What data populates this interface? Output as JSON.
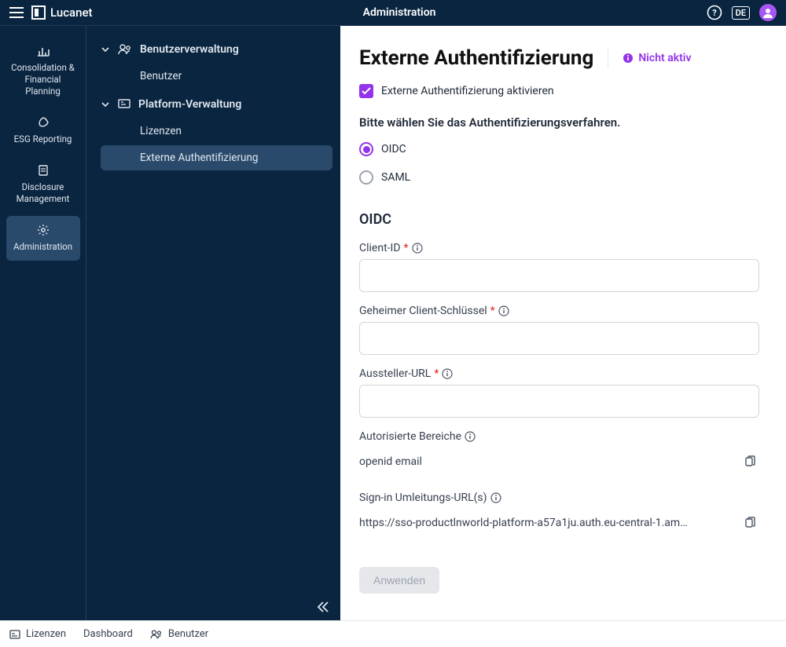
{
  "topbar": {
    "brand": "Lucanet",
    "title": "Administration",
    "lang": "DE"
  },
  "rail": {
    "items": [
      {
        "label": "Consolidation & Financial Planning",
        "icon": "chart"
      },
      {
        "label": "ESG Reporting",
        "icon": "leaf"
      },
      {
        "label": "Disclosure Management",
        "icon": "doc"
      },
      {
        "label": "Administration",
        "icon": "gear",
        "active": true
      }
    ]
  },
  "secondary": {
    "groups": [
      {
        "label": "Benutzerverwaltung",
        "icon": "users",
        "children": [
          {
            "label": "Benutzer"
          }
        ]
      },
      {
        "label": "Platform-Verwaltung",
        "icon": "platform",
        "children": [
          {
            "label": "Lizenzen"
          },
          {
            "label": "Externe Authentifizierung",
            "active": true
          }
        ]
      }
    ]
  },
  "content": {
    "heading": "Externe Authentifizierung",
    "status": "Nicht aktiv",
    "enable_label": "Externe Authentifizierung aktivieren",
    "enable_checked": true,
    "prompt": "Bitte wählen Sie das Authentifizierungsverfahren.",
    "radios": {
      "oidc": "OIDC",
      "saml": "SAML",
      "selected": "oidc"
    },
    "section_heading": "OIDC",
    "fields": {
      "client_id": {
        "label": "Client-ID",
        "required": true,
        "value": ""
      },
      "client_secret": {
        "label": "Geheimer Client-Schlüssel",
        "required": true,
        "value": ""
      },
      "issuer_url": {
        "label": "Aussteller-URL",
        "required": true,
        "value": ""
      },
      "scopes": {
        "label": "Autorisierte Bereiche",
        "value": "openid email"
      },
      "redirect": {
        "label": "Sign-in Umleitungs-URL(s)",
        "value": "https://sso-productlnworld-platform-a57a1ju.auth.eu-central-1.am…"
      }
    },
    "apply_label": "Anwenden"
  },
  "bottombar": {
    "items": [
      {
        "label": "Lizenzen",
        "icon": "license"
      },
      {
        "label": "Dashboard",
        "icon": ""
      },
      {
        "label": "Benutzer",
        "icon": "users"
      }
    ]
  }
}
